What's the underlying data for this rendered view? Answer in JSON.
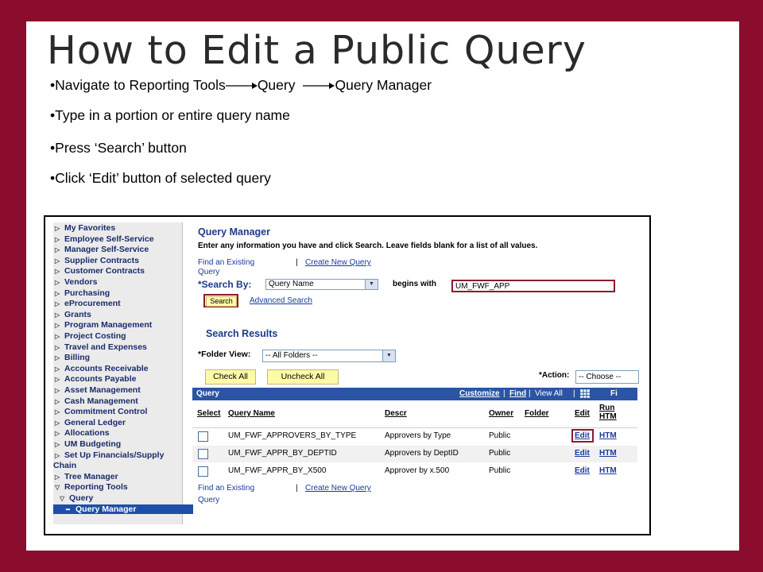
{
  "slide": {
    "title": "How to Edit a Public Query",
    "bullets": [
      {
        "segments": [
          "Navigate to Reporting Tools",
          "Query",
          "Query Manager"
        ]
      },
      {
        "text": "Type in a portion or entire query name"
      },
      {
        "text": "Press ‘Search’ button"
      },
      {
        "text": "Click ‘Edit’ button of selected query"
      }
    ],
    "colors": {
      "frame": "#8b0d2d",
      "highlight": "#8b1a2e",
      "link": "#1b3aa0",
      "grid_header": "#2b55a4",
      "button": "#fffaa8"
    }
  },
  "menu": {
    "items": [
      {
        "label": "My Favorites",
        "icon": "triangle-right-icon"
      },
      {
        "label": "Employee Self-Service",
        "icon": "triangle-right-icon"
      },
      {
        "label": "Manager Self-Service",
        "icon": "triangle-right-icon"
      },
      {
        "label": "Supplier Contracts",
        "icon": "triangle-right-icon"
      },
      {
        "label": "Customer Contracts",
        "icon": "triangle-right-icon"
      },
      {
        "label": "Vendors",
        "icon": "triangle-right-icon"
      },
      {
        "label": "Purchasing",
        "icon": "triangle-right-icon"
      },
      {
        "label": "eProcurement",
        "icon": "triangle-right-icon"
      },
      {
        "label": "Grants",
        "icon": "triangle-right-icon"
      },
      {
        "label": "Program Management",
        "icon": "triangle-right-icon"
      },
      {
        "label": "Project Costing",
        "icon": "triangle-right-icon"
      },
      {
        "label": "Travel and Expenses",
        "icon": "triangle-right-icon"
      },
      {
        "label": "Billing",
        "icon": "triangle-right-icon"
      },
      {
        "label": "Accounts Receivable",
        "icon": "triangle-right-icon"
      },
      {
        "label": "Accounts Payable",
        "icon": "triangle-right-icon"
      },
      {
        "label": "Asset Management",
        "icon": "triangle-right-icon"
      },
      {
        "label": "Cash Management",
        "icon": "triangle-right-icon"
      },
      {
        "label": "Commitment Control",
        "icon": "triangle-right-icon"
      },
      {
        "label": "General Ledger",
        "icon": "triangle-right-icon"
      },
      {
        "label": "Allocations",
        "icon": "triangle-right-icon"
      },
      {
        "label": "UM Budgeting",
        "icon": "triangle-right-icon"
      },
      {
        "label": "Set Up Financials/Supply",
        "icon": "triangle-right-icon"
      },
      {
        "label": "Chain",
        "icon": ""
      },
      {
        "label": "Tree Manager",
        "icon": "triangle-right-icon"
      },
      {
        "label": "Reporting Tools",
        "icon": "triangle-down-icon"
      },
      {
        "label": "Query",
        "icon": "triangle-down-icon"
      },
      {
        "label": "Query Manager",
        "icon": "dash-icon"
      }
    ]
  },
  "page": {
    "title": "Query Manager",
    "instructions": "Enter any information you have and click Search. Leave fields blank for a list of all values.",
    "find_existing": "Find an Existing",
    "find_existing_2": "Query",
    "separator": "|",
    "create_new": "Create New Query",
    "search_by_label": "*Search By:",
    "search_by_value": "Query Name",
    "begins_with": "begins with",
    "search_value": "UM_FWF_APP",
    "search_button": "Search",
    "advanced_search": "Advanced Search",
    "results_title": "Search Results",
    "folder_view_label": "*Folder View:",
    "folder_view_value": "-- All Folders --",
    "check_all": "Check All",
    "uncheck_all": "Uncheck All",
    "action_label": "*Action:",
    "action_value": "-- Choose --",
    "grid": {
      "title": "Query",
      "customize": "Customize",
      "find": "Find",
      "view_all": "View All",
      "first": "Fi",
      "columns": {
        "select": "Select",
        "name": "Query Name",
        "descr": "Descr",
        "owner": "Owner",
        "folder": "Folder",
        "edit": "Edit",
        "run1": "Run",
        "run2": "HTM"
      },
      "rows": [
        {
          "name": "UM_FWF_APPROVERS_BY_TYPE",
          "descr": "Approvers by Type",
          "owner": "Public",
          "folder": "",
          "edit": "Edit",
          "run": "HTM"
        },
        {
          "name": "UM_FWF_APPR_BY_DEPTID",
          "descr": "Approvers by DeptID",
          "owner": "Public",
          "folder": "",
          "edit": "Edit",
          "run": "HTM"
        },
        {
          "name": "UM_FWF_APPR_BY_X500",
          "descr": "Approver by x.500",
          "owner": "Public",
          "folder": "",
          "edit": "Edit",
          "run": "HTM"
        }
      ]
    }
  }
}
